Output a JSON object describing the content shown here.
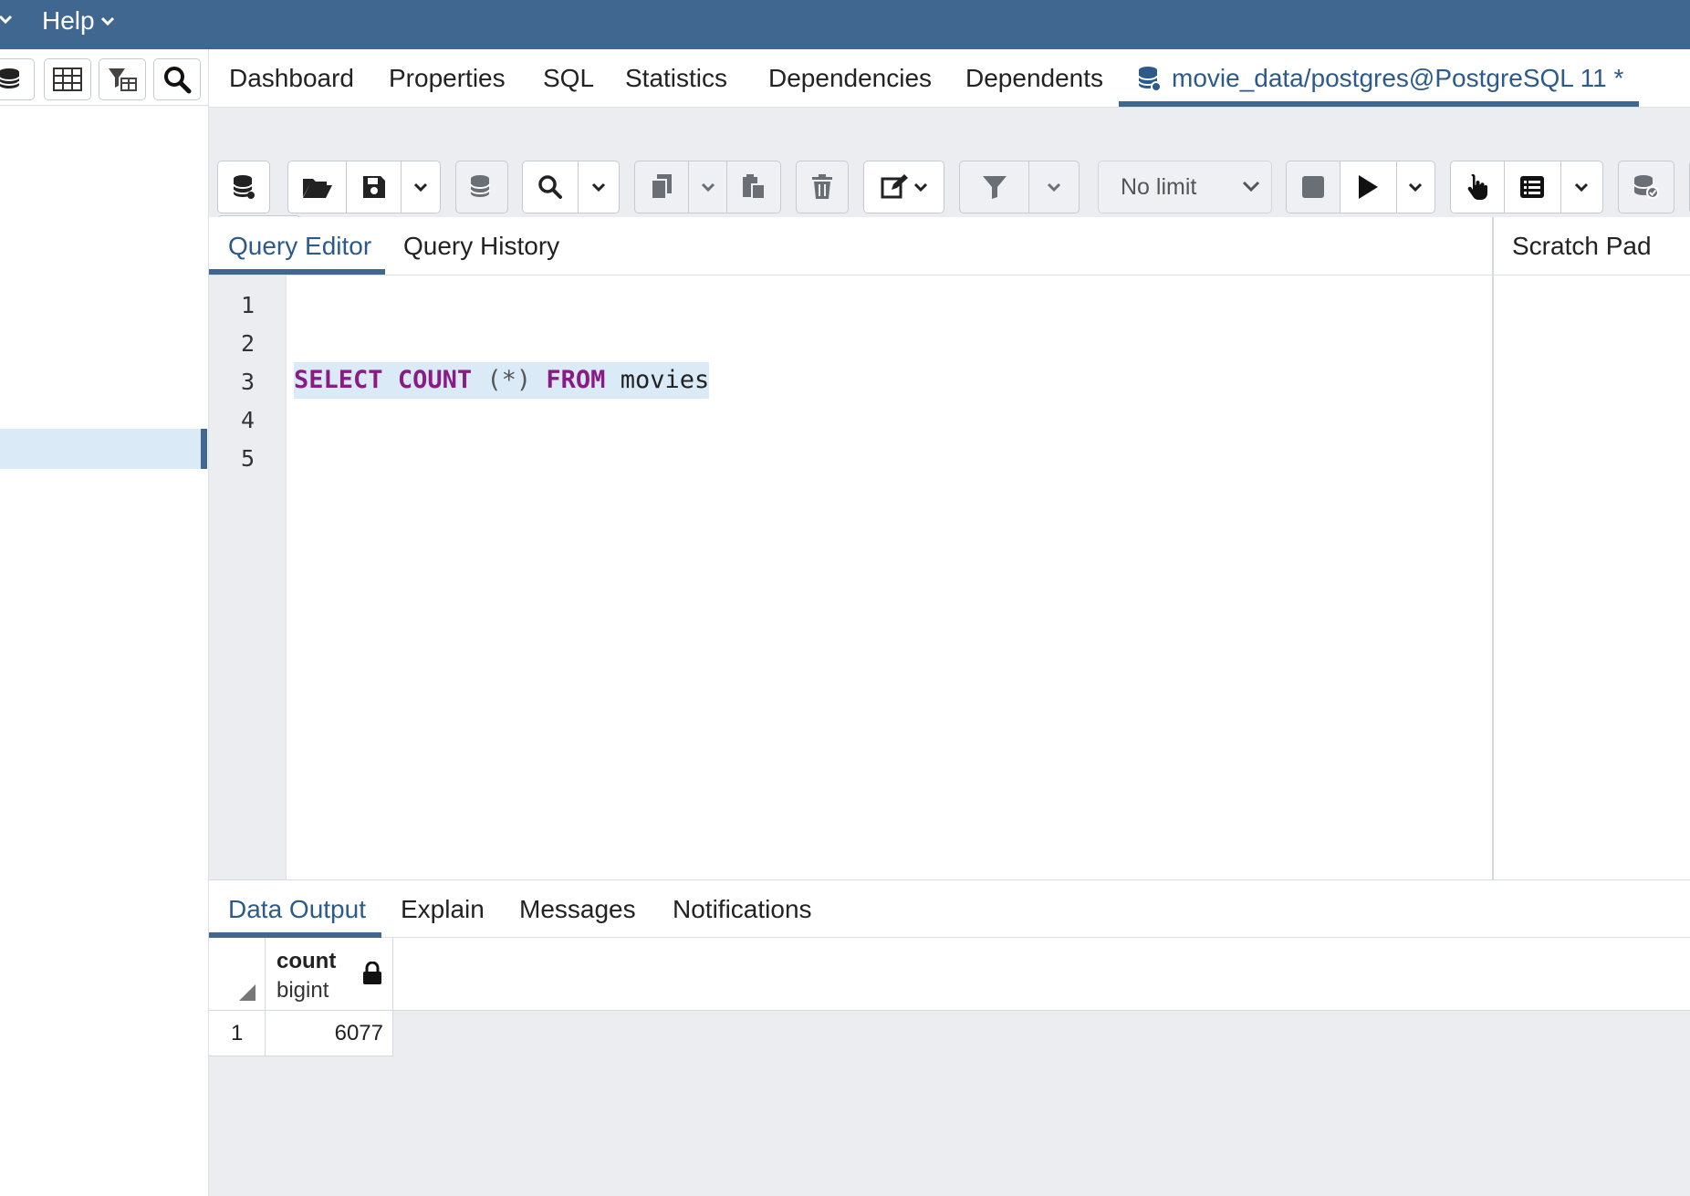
{
  "menubar": {
    "help_label": "Help"
  },
  "panel_tabs": [
    {
      "label": "Dashboard"
    },
    {
      "label": "Properties"
    },
    {
      "label": "SQL"
    },
    {
      "label": "Statistics"
    },
    {
      "label": "Dependencies"
    },
    {
      "label": "Dependents"
    },
    {
      "label": "movie_data/postgres@PostgreSQL 11 *"
    }
  ],
  "toolbar": {
    "row_limit": "No limit"
  },
  "query_tabs": {
    "editor": "Query Editor",
    "history": "Query History",
    "scratch_pad": "Scratch Pad"
  },
  "editor": {
    "line_numbers": [
      "1",
      "2",
      "3",
      "4",
      "5"
    ],
    "line3": {
      "kw1": "SELECT",
      "kw2": "COUNT",
      "paren": "(*)",
      "kw3": "FROM",
      "table": "movies"
    }
  },
  "output_tabs": {
    "data_output": "Data Output",
    "explain": "Explain",
    "messages": "Messages",
    "notifications": "Notifications"
  },
  "results": {
    "columns": [
      {
        "name": "count",
        "type": "bigint"
      }
    ],
    "rows": [
      {
        "num": "1",
        "count": "6077"
      }
    ]
  },
  "colors": {
    "header_bg": "#3f6790",
    "accent": "#2c5a8a",
    "keyword": "#8a1a87",
    "selection": "#dbeaf7"
  }
}
